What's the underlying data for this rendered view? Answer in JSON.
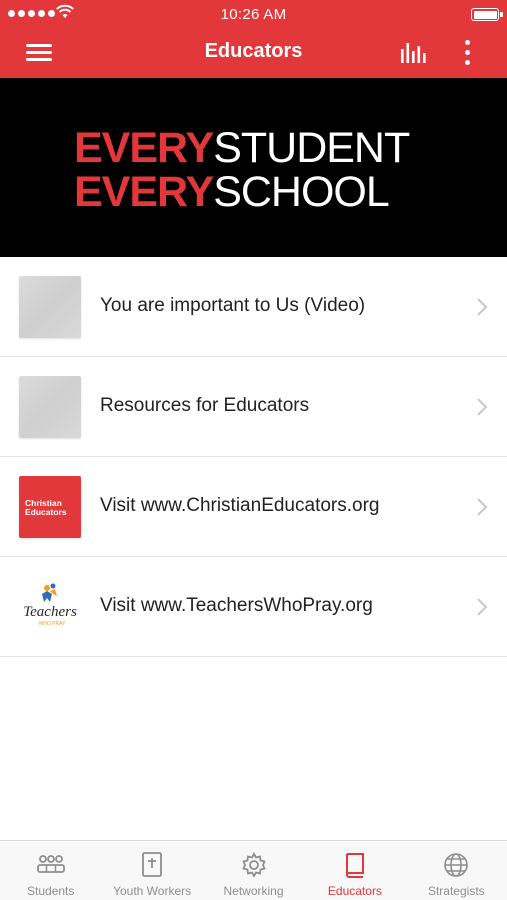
{
  "status_bar": {
    "time": "10:26 AM",
    "icons": [
      "signal-dots-icon",
      "wifi-icon",
      "battery-icon"
    ]
  },
  "nav": {
    "title": "Educators",
    "icons": [
      "hamburger-menu-icon",
      "bar-chart-icon",
      "more-vertical-icon"
    ]
  },
  "banner": {
    "line1_red": "EVERY",
    "line1_white": "STUDENT",
    "line2_red": "EVERY",
    "line2_white": "SCHOOL"
  },
  "list": [
    {
      "label": "You are important to Us (Video)",
      "thumb": "placeholder-image"
    },
    {
      "label": "Resources for Educators",
      "thumb": "placeholder-image"
    },
    {
      "label": "Visit www.ChristianEducators.org",
      "thumb": "christian-educators-logo",
      "logo_text": [
        "Christian",
        "Educators"
      ]
    },
    {
      "label": "Visit www.TeachersWhoPray.org",
      "thumb": "teachers-who-pray-logo",
      "logo_text": [
        "Teachers",
        "WHO PRAY"
      ]
    }
  ],
  "tabs": [
    {
      "label": "Students",
      "icon": "group-icon"
    },
    {
      "label": "Youth Workers",
      "icon": "bible-icon"
    },
    {
      "label": "Networking",
      "icon": "gear-icon"
    },
    {
      "label": "Educators",
      "icon": "book-icon",
      "active": true
    },
    {
      "label": "Strategists",
      "icon": "globe-icon"
    }
  ],
  "colors": {
    "accent": "#e2383b",
    "banner_background": "#000000",
    "tab_inactive": "#8e8e8e"
  }
}
